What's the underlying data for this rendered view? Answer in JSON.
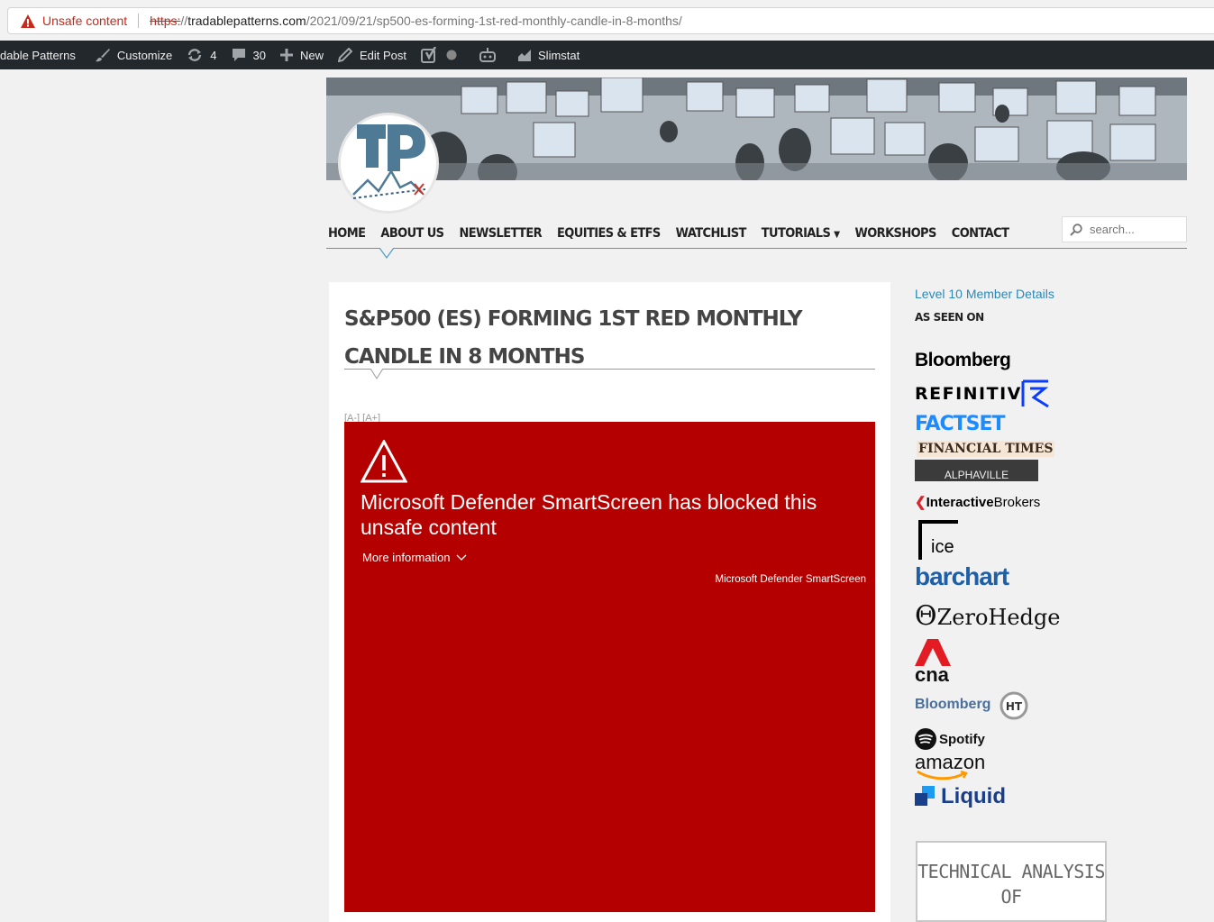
{
  "browser": {
    "warning": "Unsafe content",
    "url_protocol": "https:",
    "url_slashes": "//",
    "url_host": "tradablepatterns.com",
    "url_path": "/2021/09/21/sp500-es-forming-1st-red-monthly-candle-in-8-months/"
  },
  "admin_bar": {
    "site_name": "dable Patterns",
    "customize": "Customize",
    "updates": "4",
    "comments": "30",
    "new": "New",
    "edit_post": "Edit Post",
    "slimstat": "Slimstat"
  },
  "nav": {
    "items": [
      "HOME",
      "ABOUT US",
      "NEWSLETTER",
      "EQUITIES & ETFS",
      "WATCHLIST",
      "TUTORIALS",
      "WORKSHOPS",
      "CONTACT"
    ],
    "search_placeholder": "search..."
  },
  "post": {
    "title": "S&P500 (ES) Forming 1st Red Monthly Candle in 8 Months",
    "font_controls": "[A-] [A+]"
  },
  "blocked": {
    "message": "Microsoft Defender SmartScreen has blocked this unsafe content",
    "more_info": "More information",
    "brand": "Microsoft Defender SmartScreen"
  },
  "sidebar": {
    "member_link": "Level 10 Member Details",
    "heading": "AS SEEN ON",
    "logos": {
      "bloomberg": "Bloomberg",
      "refinitiv": "REFINITIV",
      "factset": "FACTSET",
      "ft": "FINANCIAL TIMES",
      "alphaville": "ALPHAVILLE",
      "ib_interactive": "Interactive",
      "ib_brokers": "Brokers",
      "ice": "ice",
      "barchart": "barchart",
      "zerohedge": "ZeroHedge",
      "cna": "cna",
      "bloomberg_ht": "Bloomberg",
      "spotify": "Spotify",
      "amazon": "amazon",
      "liquid": "Liquid"
    },
    "book_title_line1": "TECHNICAL ANALYSIS",
    "book_title_line2": "OF"
  },
  "colors": {
    "danger": "#c42b1c",
    "smartscreen_red": "#b50000",
    "admin_bar": "#23282d",
    "nav_accent": "#4b9bbf",
    "link": "#2b89b8"
  }
}
